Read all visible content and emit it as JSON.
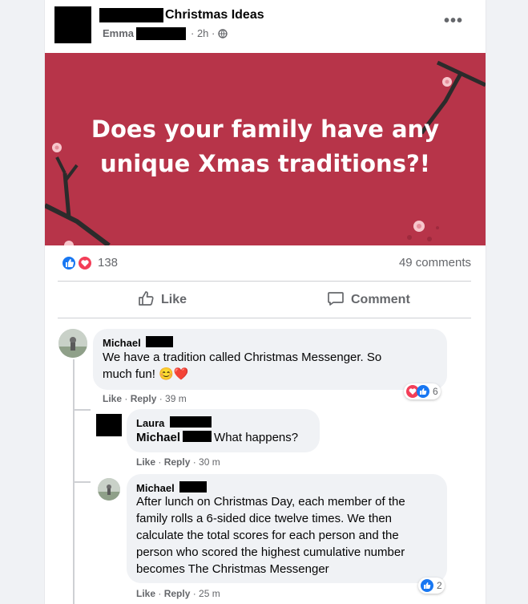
{
  "post": {
    "group_name": "Christmas Ideas",
    "author": "Emma",
    "time": "· 2h ·",
    "privacy_icon": "globe-icon",
    "more_icon": "more-dots-icon",
    "more_label": "•••",
    "banner_line1": "Does your family have any",
    "banner_line2": "unique Xmas traditions?!",
    "banner_color": "#b73449",
    "reaction_count": "138",
    "comments_count": "49 comments",
    "like_label": "Like",
    "comment_label": "Comment"
  },
  "comments": [
    {
      "name": "Michael",
      "text_line1": "We have a tradition called Christmas Messenger. So",
      "text_line2": "much fun! 😊❤️",
      "like": "Like",
      "reply": "Reply",
      "time": "· 39 m",
      "reaction_count": "6"
    },
    {
      "name": "Laura",
      "tag": "Michael",
      "text": "What happens?",
      "like": "Like",
      "reply": "Reply",
      "time": "· 30 m"
    },
    {
      "name": "Michael",
      "lines": [
        "After lunch on Christmas Day, each member of the",
        "family rolls a 6-sided dice twelve times. We then",
        "calculate the total scores for each person and the",
        "person who scored the highest cumulative number",
        "becomes The Christmas Messenger"
      ],
      "like": "Like",
      "reply": "Reply",
      "time": "· 25 m",
      "reaction_count": "2"
    }
  ],
  "colors": {
    "like_blue": "#1877f2",
    "love_red": "#f33e58",
    "muted": "#65676b",
    "bubble": "#f0f2f5"
  }
}
